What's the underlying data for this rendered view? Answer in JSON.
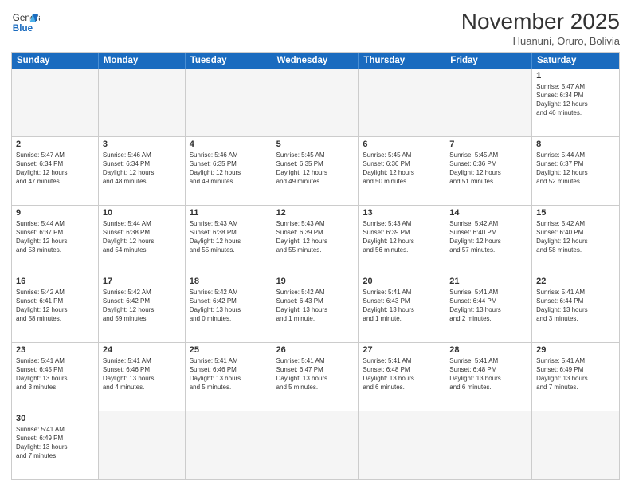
{
  "header": {
    "logo_general": "General",
    "logo_blue": "Blue",
    "title": "November 2025",
    "subtitle": "Huanuni, Oruro, Bolivia"
  },
  "days_of_week": [
    "Sunday",
    "Monday",
    "Tuesday",
    "Wednesday",
    "Thursday",
    "Friday",
    "Saturday"
  ],
  "weeks": [
    [
      {
        "day": "",
        "info": "",
        "empty": true
      },
      {
        "day": "",
        "info": "",
        "empty": true
      },
      {
        "day": "",
        "info": "",
        "empty": true
      },
      {
        "day": "",
        "info": "",
        "empty": true
      },
      {
        "day": "",
        "info": "",
        "empty": true
      },
      {
        "day": "",
        "info": "",
        "empty": true
      },
      {
        "day": "1",
        "info": "Sunrise: 5:47 AM\nSunset: 6:34 PM\nDaylight: 12 hours\nand 46 minutes.",
        "empty": false
      }
    ],
    [
      {
        "day": "2",
        "info": "Sunrise: 5:47 AM\nSunset: 6:34 PM\nDaylight: 12 hours\nand 47 minutes.",
        "empty": false
      },
      {
        "day": "3",
        "info": "Sunrise: 5:46 AM\nSunset: 6:34 PM\nDaylight: 12 hours\nand 48 minutes.",
        "empty": false
      },
      {
        "day": "4",
        "info": "Sunrise: 5:46 AM\nSunset: 6:35 PM\nDaylight: 12 hours\nand 49 minutes.",
        "empty": false
      },
      {
        "day": "5",
        "info": "Sunrise: 5:45 AM\nSunset: 6:35 PM\nDaylight: 12 hours\nand 49 minutes.",
        "empty": false
      },
      {
        "day": "6",
        "info": "Sunrise: 5:45 AM\nSunset: 6:36 PM\nDaylight: 12 hours\nand 50 minutes.",
        "empty": false
      },
      {
        "day": "7",
        "info": "Sunrise: 5:45 AM\nSunset: 6:36 PM\nDaylight: 12 hours\nand 51 minutes.",
        "empty": false
      },
      {
        "day": "8",
        "info": "Sunrise: 5:44 AM\nSunset: 6:37 PM\nDaylight: 12 hours\nand 52 minutes.",
        "empty": false
      }
    ],
    [
      {
        "day": "9",
        "info": "Sunrise: 5:44 AM\nSunset: 6:37 PM\nDaylight: 12 hours\nand 53 minutes.",
        "empty": false
      },
      {
        "day": "10",
        "info": "Sunrise: 5:44 AM\nSunset: 6:38 PM\nDaylight: 12 hours\nand 54 minutes.",
        "empty": false
      },
      {
        "day": "11",
        "info": "Sunrise: 5:43 AM\nSunset: 6:38 PM\nDaylight: 12 hours\nand 55 minutes.",
        "empty": false
      },
      {
        "day": "12",
        "info": "Sunrise: 5:43 AM\nSunset: 6:39 PM\nDaylight: 12 hours\nand 55 minutes.",
        "empty": false
      },
      {
        "day": "13",
        "info": "Sunrise: 5:43 AM\nSunset: 6:39 PM\nDaylight: 12 hours\nand 56 minutes.",
        "empty": false
      },
      {
        "day": "14",
        "info": "Sunrise: 5:42 AM\nSunset: 6:40 PM\nDaylight: 12 hours\nand 57 minutes.",
        "empty": false
      },
      {
        "day": "15",
        "info": "Sunrise: 5:42 AM\nSunset: 6:40 PM\nDaylight: 12 hours\nand 58 minutes.",
        "empty": false
      }
    ],
    [
      {
        "day": "16",
        "info": "Sunrise: 5:42 AM\nSunset: 6:41 PM\nDaylight: 12 hours\nand 58 minutes.",
        "empty": false
      },
      {
        "day": "17",
        "info": "Sunrise: 5:42 AM\nSunset: 6:42 PM\nDaylight: 12 hours\nand 59 minutes.",
        "empty": false
      },
      {
        "day": "18",
        "info": "Sunrise: 5:42 AM\nSunset: 6:42 PM\nDaylight: 13 hours\nand 0 minutes.",
        "empty": false
      },
      {
        "day": "19",
        "info": "Sunrise: 5:42 AM\nSunset: 6:43 PM\nDaylight: 13 hours\nand 1 minute.",
        "empty": false
      },
      {
        "day": "20",
        "info": "Sunrise: 5:41 AM\nSunset: 6:43 PM\nDaylight: 13 hours\nand 1 minute.",
        "empty": false
      },
      {
        "day": "21",
        "info": "Sunrise: 5:41 AM\nSunset: 6:44 PM\nDaylight: 13 hours\nand 2 minutes.",
        "empty": false
      },
      {
        "day": "22",
        "info": "Sunrise: 5:41 AM\nSunset: 6:44 PM\nDaylight: 13 hours\nand 3 minutes.",
        "empty": false
      }
    ],
    [
      {
        "day": "23",
        "info": "Sunrise: 5:41 AM\nSunset: 6:45 PM\nDaylight: 13 hours\nand 3 minutes.",
        "empty": false
      },
      {
        "day": "24",
        "info": "Sunrise: 5:41 AM\nSunset: 6:46 PM\nDaylight: 13 hours\nand 4 minutes.",
        "empty": false
      },
      {
        "day": "25",
        "info": "Sunrise: 5:41 AM\nSunset: 6:46 PM\nDaylight: 13 hours\nand 5 minutes.",
        "empty": false
      },
      {
        "day": "26",
        "info": "Sunrise: 5:41 AM\nSunset: 6:47 PM\nDaylight: 13 hours\nand 5 minutes.",
        "empty": false
      },
      {
        "day": "27",
        "info": "Sunrise: 5:41 AM\nSunset: 6:48 PM\nDaylight: 13 hours\nand 6 minutes.",
        "empty": false
      },
      {
        "day": "28",
        "info": "Sunrise: 5:41 AM\nSunset: 6:48 PM\nDaylight: 13 hours\nand 6 minutes.",
        "empty": false
      },
      {
        "day": "29",
        "info": "Sunrise: 5:41 AM\nSunset: 6:49 PM\nDaylight: 13 hours\nand 7 minutes.",
        "empty": false
      }
    ],
    [
      {
        "day": "30",
        "info": "Sunrise: 5:41 AM\nSunset: 6:49 PM\nDaylight: 13 hours\nand 7 minutes.",
        "empty": false
      },
      {
        "day": "",
        "info": "",
        "empty": true
      },
      {
        "day": "",
        "info": "",
        "empty": true
      },
      {
        "day": "",
        "info": "",
        "empty": true
      },
      {
        "day": "",
        "info": "",
        "empty": true
      },
      {
        "day": "",
        "info": "",
        "empty": true
      },
      {
        "day": "",
        "info": "",
        "empty": true
      }
    ]
  ]
}
